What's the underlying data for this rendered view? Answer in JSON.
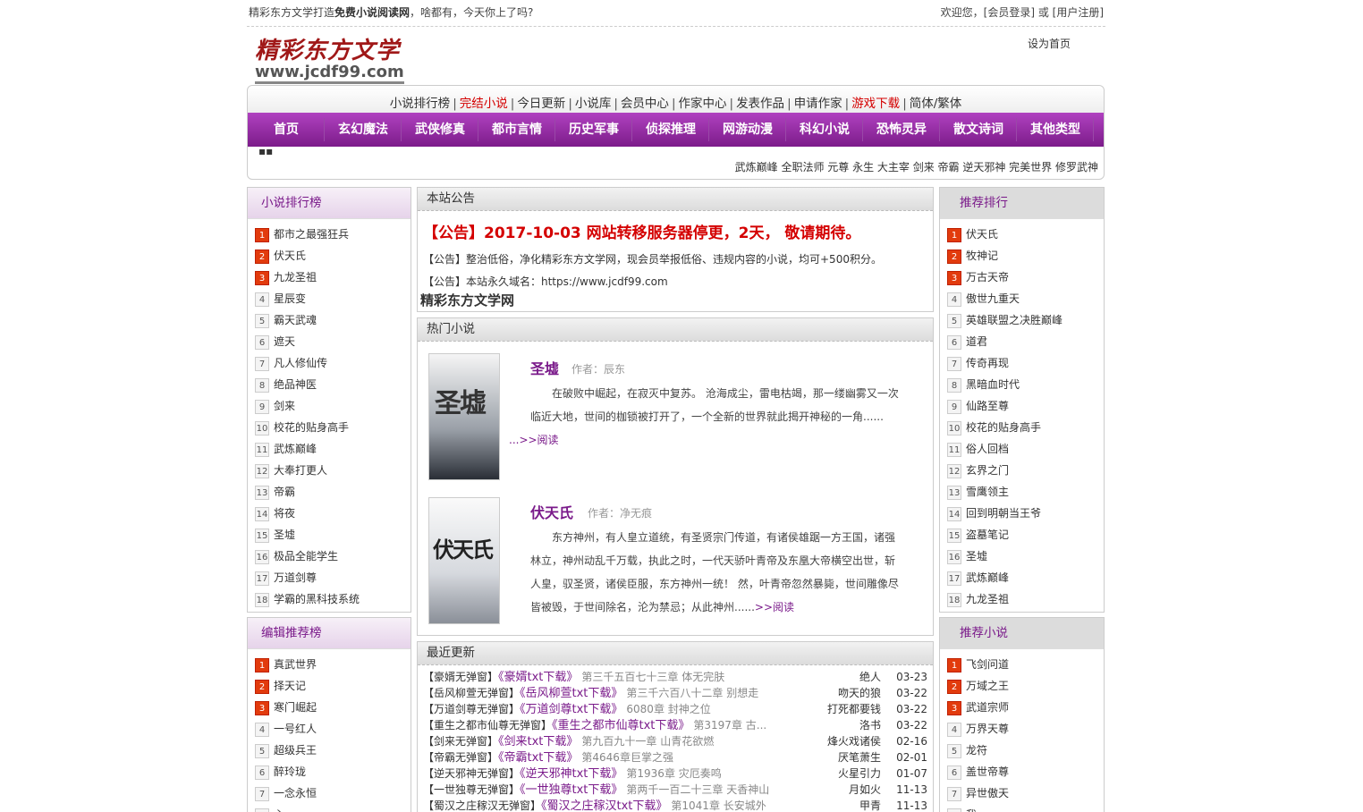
{
  "topbar": {
    "intro_prefix": "精彩东方文学打造",
    "intro_bold": "免费小说阅读网",
    "intro_suffix": "，啥都有，今天你上了吗?",
    "welcome": "欢迎您，[会员登录] 或 [用户注册]"
  },
  "logo": {
    "cn": "精彩东方文学",
    "en": "www.jcdf99.com"
  },
  "set_home": "设为首页",
  "subnav": [
    {
      "label": "小说排行榜",
      "hot": false
    },
    {
      "label": "完结小说",
      "hot": true
    },
    {
      "label": "今日更新",
      "hot": false
    },
    {
      "label": "小说库",
      "hot": false
    },
    {
      "label": "会员中心",
      "hot": false
    },
    {
      "label": "作家中心",
      "hot": false
    },
    {
      "label": "发表作品",
      "hot": false
    },
    {
      "label": "申请作家",
      "hot": false
    },
    {
      "label": "游戏下载",
      "hot": true
    },
    {
      "label": "简体/繁体",
      "hot": false
    }
  ],
  "mainnav": [
    "首页",
    "玄幻魔法",
    "武侠修真",
    "都市言情",
    "历史军事",
    "侦探推理",
    "网游动漫",
    "科幻小说",
    "恐怖灵异",
    "散文诗词",
    "其他类型"
  ],
  "hotwords": "武炼巅峰 全职法师 元尊 永生 大主宰 剑来 帝霸 逆天邪神 完美世界 修罗武神",
  "navdot": "▪▪",
  "left_rank": {
    "title": "小说排行榜",
    "items": [
      "都市之最强狂兵",
      "伏天氏",
      "九龙圣祖",
      "星辰变",
      "霸天武魂",
      "遮天",
      "凡人修仙传",
      "绝品神医",
      "剑来",
      "校花的贴身高手",
      "武炼巅峰",
      "大奉打更人",
      "帝霸",
      "将夜",
      "圣墟",
      "极品全能学生",
      "万道剑尊",
      "学霸的黑科技系统"
    ]
  },
  "left_editor": {
    "title": "编辑推荐榜",
    "items": [
      "真武世界",
      "择天记",
      "寒门崛起",
      "一号红人",
      "超级兵王",
      "醉玲珑",
      "一念永恒",
      "心"
    ]
  },
  "right_rank": {
    "title": "推荐排行",
    "items": [
      "伏天氏",
      "牧神记",
      "万古天帝",
      "傲世九重天",
      "英雄联盟之决胜巅峰",
      "道君",
      "传奇再现",
      "黑暗血时代",
      "仙路至尊",
      "校花的贴身高手",
      "俗人回档",
      "玄界之门",
      "雪鹰领主",
      "回到明朝当王爷",
      "盗墓笔记",
      "圣墟",
      "武炼巅峰",
      "九龙圣祖"
    ]
  },
  "right_recommend": {
    "title": "推荐小说",
    "items": [
      "飞剑问道",
      "万域之王",
      "武道宗师",
      "万界天尊",
      "龙符",
      "盖世帝尊",
      "异世傲天",
      "我"
    ]
  },
  "notice": {
    "head": "本站公告",
    "title": "【公告】2017-10-03 网站转移服务器停更，2天， 敬请期待。",
    "line1": "【公告】整治低俗，净化精彩东方文学网，现会员举报低俗、违规内容的小说，均可+500积分。",
    "line2": "【公告】本站永久域名：https://www.jcdf99.com",
    "site": "精彩东方文学网"
  },
  "hot": {
    "head": "热门小说",
    "books": [
      {
        "cover_text": "圣墟",
        "title": "圣墟",
        "author": "作者：辰东",
        "desc": "在破败中崛起，在寂灭中复苏。 沧海成尘，雷电枯竭，那一缕幽雾又一次临近大地，世间的枷锁被打开了，一个全新的世界就此揭开神秘的一角......",
        "more": "...>>阅读"
      },
      {
        "cover_text": "伏天氏",
        "title": "伏天氏",
        "author": "作者：净无痕",
        "desc": "东方神州，有人皇立道统，有圣贤宗门传道，有诸侯雄踞一方王国，诸强林立，神州动乱千万载，执此之时，一代天骄叶青帝及东凰大帝横空出世，斩人皇，驭圣贤，诸侯臣服，东方神州一统！ 然，叶青帝忽然暴毙，世间雕像尽皆被毁，于世间除名，沦为禁忌；从此神州......",
        "more": ">>阅读"
      }
    ]
  },
  "updates": {
    "head": "最近更新",
    "rows": [
      {
        "tag": "【豪婿无弹窗】",
        "book": "《豪婿txt下载》",
        "chapter": "第三千五百七十三章 体无完肤",
        "author": "绝人",
        "date": "03-23"
      },
      {
        "tag": "【岳风柳萱无弹窗】",
        "book": "《岳风柳萱txt下载》",
        "chapter": "第三千六百八十二章 别想走",
        "author": "吻天的狼",
        "date": "03-22"
      },
      {
        "tag": "【万道剑尊无弹窗】",
        "book": "《万道剑尊txt下载》",
        "chapter": "6080章 封神之位",
        "author": "打死都要钱",
        "date": "03-22"
      },
      {
        "tag": "【重生之都市仙尊无弹窗】",
        "book": "《重生之都市仙尊txt下载》",
        "chapter": "第3197章 古...",
        "author": "洛书",
        "date": "03-22"
      },
      {
        "tag": "【剑来无弹窗】",
        "book": "《剑来txt下载》",
        "chapter": "第九百九十一章 山青花欲燃",
        "author": "烽火戏诸侯",
        "date": "02-16"
      },
      {
        "tag": "【帝霸无弹窗】",
        "book": "《帝霸txt下载》",
        "chapter": "第4646章巨掌之强",
        "author": "厌笔萧生",
        "date": "02-01"
      },
      {
        "tag": "【逆天邪神无弹窗】",
        "book": "《逆天邪神txt下载》",
        "chapter": "第1936章 灾厄奏鸣",
        "author": "火星引力",
        "date": "01-07"
      },
      {
        "tag": "【一世独尊无弹窗】",
        "book": "《一世独尊txt下载》",
        "chapter": "第两千一百二十三章 天香神山",
        "author": "月如火",
        "date": "11-13"
      },
      {
        "tag": "【蜀汉之庄稼汉无弹窗】",
        "book": "《蜀汉之庄稼汉txt下载》",
        "chapter": "第1041章 长安城外",
        "author": "甲青",
        "date": "11-13"
      }
    ]
  },
  "colors": {
    "purple": "#7a1a8a",
    "nav": "#9a2aa8",
    "red": "#d40000",
    "rank_top": "#e23b0d"
  }
}
